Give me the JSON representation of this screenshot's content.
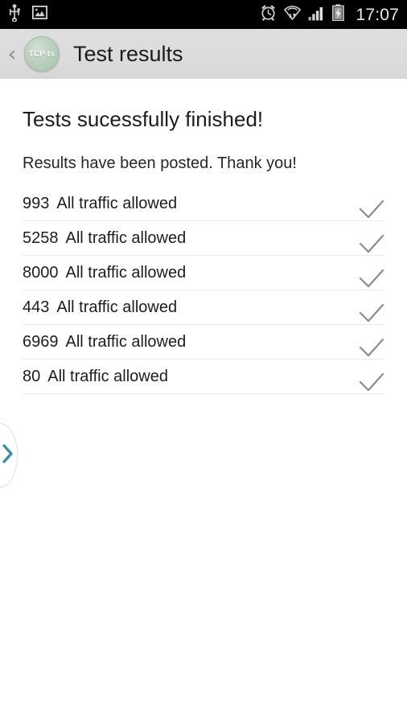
{
  "status_bar": {
    "icons_left": [
      "usb-icon",
      "screenshot-image-icon"
    ],
    "icons_right": [
      "alarm-clock-icon",
      "wifi-icon",
      "cellular-signal-icon",
      "battery-charging-icon"
    ],
    "clock": "17:07",
    "background_color": "#000000",
    "foreground_color": "#e8e8e8"
  },
  "action_bar": {
    "back_label": "‹",
    "logo_text": "TCP ts",
    "logo_color": "#b9cfbd",
    "title": "Test results",
    "background_color": "#dcdcdc"
  },
  "content": {
    "headline": "Tests sucessfully finished!",
    "subline": "Results have been posted. Thank you!"
  },
  "results": {
    "check_color": "#8c8c8c",
    "divider_color": "#e9e9e9",
    "rows": [
      {
        "port": "993",
        "status": "All traffic allowed",
        "check": "check-icon"
      },
      {
        "port": "5258",
        "status": "All traffic allowed",
        "check": "check-icon"
      },
      {
        "port": "8000",
        "status": "All traffic allowed",
        "check": "check-icon"
      },
      {
        "port": "443",
        "status": "All traffic allowed",
        "check": "check-icon"
      },
      {
        "port": "6969",
        "status": "All traffic allowed",
        "check": "check-icon"
      },
      {
        "port": "80",
        "status": "All traffic allowed",
        "check": "check-icon"
      }
    ]
  },
  "drawer_handle": {
    "icon": "chevron-right-icon",
    "color": "#3f8ca6"
  }
}
